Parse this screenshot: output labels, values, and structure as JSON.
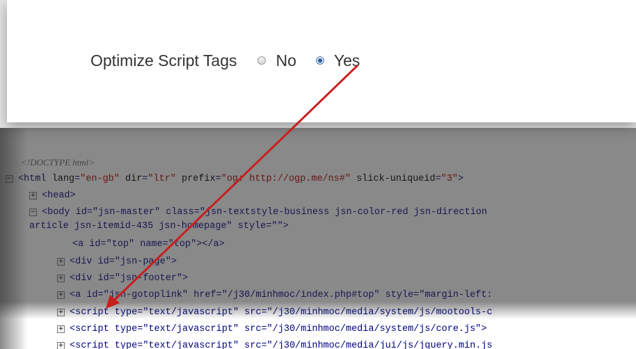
{
  "setting": {
    "label": "Optimize Script Tags",
    "options": [
      {
        "label": "No",
        "checked": false
      },
      {
        "label": "Yes",
        "checked": true
      }
    ]
  },
  "code": {
    "doctype": "<!DOCTYPE html>",
    "html_open": {
      "toggle": "−",
      "tag": "<html",
      "attrs": [
        [
          "lang",
          "\"en-gb\""
        ],
        [
          "dir",
          "\"ltr\""
        ],
        [
          "prefix",
          "\"og: http://ogp.me/ns#\""
        ],
        [
          "slick-uniqueid",
          "\"3\""
        ]
      ],
      "close": ">"
    },
    "head": {
      "toggle": "+",
      "text": "<head>"
    },
    "body_open": {
      "toggle": "−",
      "part1": "<body id=\"jsn-master\" class=\"jsn-textstyle-business jsn-color-red jsn-direction",
      "part2": "article jsn-itemid-435 jsn-homepage\" style=\"\">"
    },
    "a_top": "<a id=\"top\" name=\"top\"></a>",
    "div_page": {
      "toggle": "+",
      "text": "<div id=\"jsn-page\">"
    },
    "div_footer": {
      "toggle": "+",
      "text": "<div id=\"jsn-footer\">"
    },
    "a_goto": {
      "toggle": "+",
      "text": "<a id=\"jsn-gotoplink\" href=\"/j30/minhmoc/index.php#top\" style=\"margin-left:"
    },
    "script1": {
      "toggle": "+",
      "text": "<script type=\"text/javascript\" src=\"/j30/minhmoc/media/system/js/mootools-c"
    },
    "script2": {
      "toggle": "+",
      "text": "<script type=\"text/javascript\" src=\"/j30/minhmoc/media/system/js/core.js\">"
    },
    "script3": {
      "toggle": "+",
      "text": "<script type=\"text/javascript\" src=\"/j30/minhmoc/media/jui/js/jquery.min.js"
    }
  },
  "colors": {
    "arrow": "#c81e1e"
  }
}
